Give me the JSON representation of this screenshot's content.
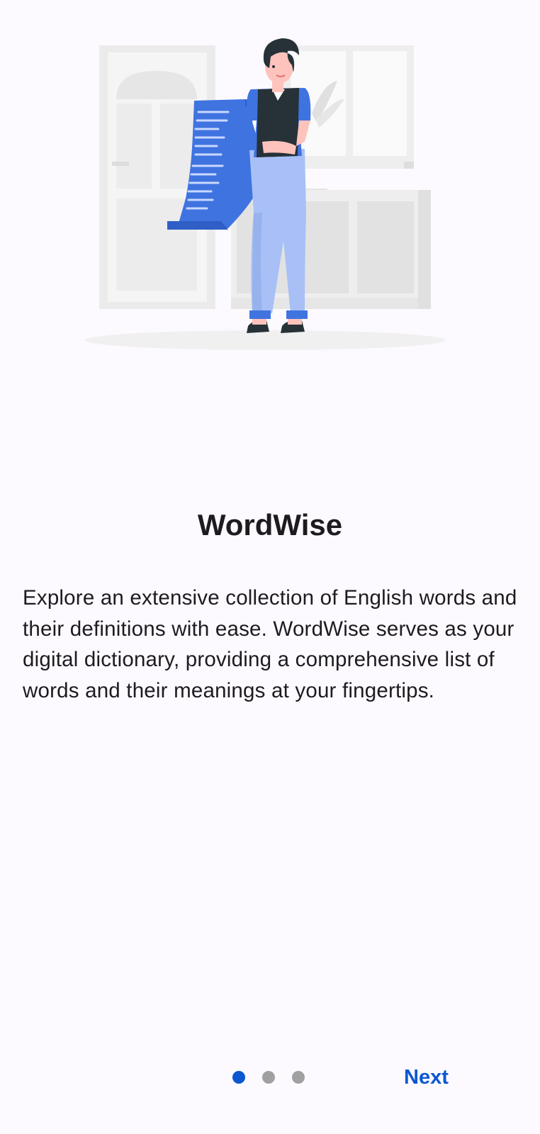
{
  "onboarding": {
    "title": "WordWise",
    "description": "Explore an extensive collection of English words and their definitions with ease. WordWise serves as your digital dictionary, providing a comprehensive list of words and their meanings at your fingertips.",
    "next_label": "Next",
    "current_page": 1,
    "total_pages": 3
  },
  "colors": {
    "accent": "#0b57d0",
    "inactive_dot": "#a0a0a0",
    "background": "#fcfaff"
  }
}
